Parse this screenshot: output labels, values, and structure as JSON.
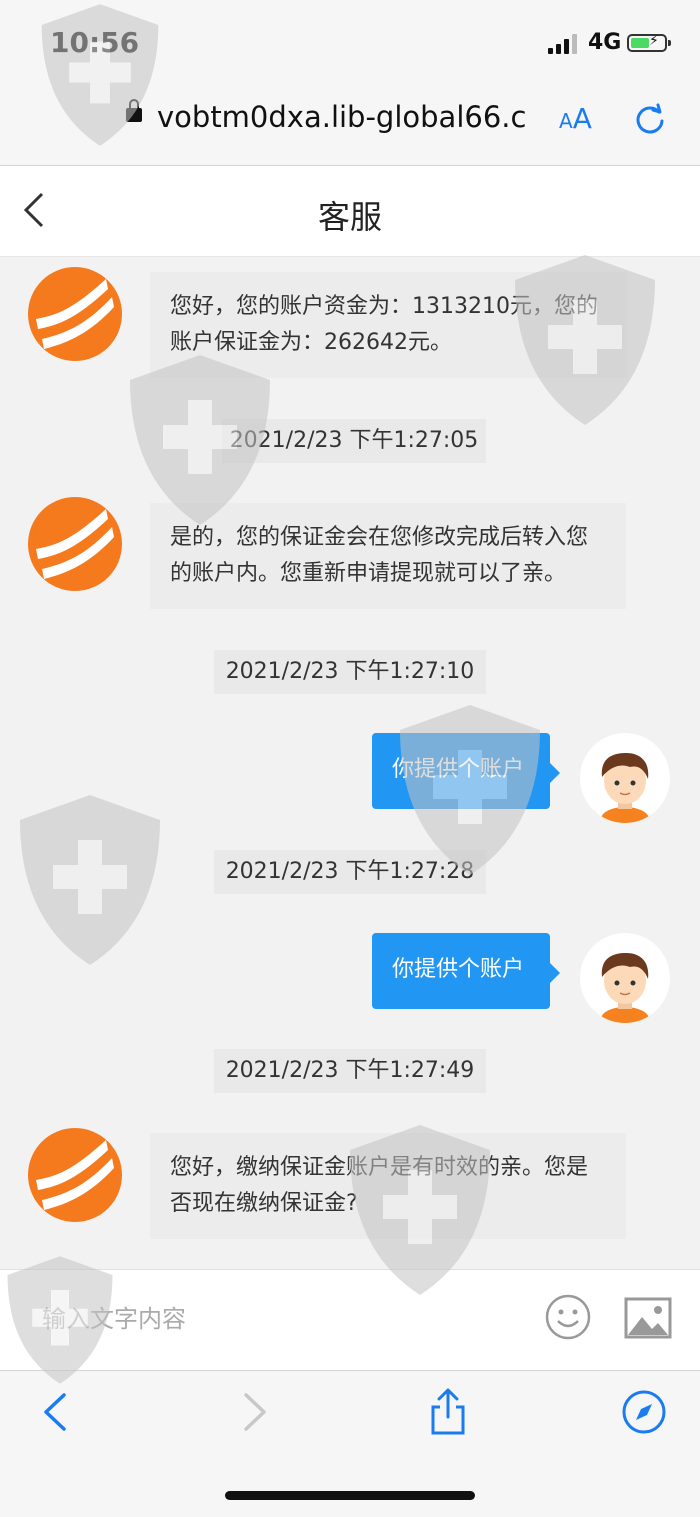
{
  "status_bar": {
    "time": "10:56",
    "network": "4G"
  },
  "browser": {
    "url": "vobtm0dxa.lib-global66.c",
    "text_size_label_small": "A",
    "text_size_label_large": "A"
  },
  "header": {
    "title": "客服"
  },
  "chat": {
    "messages": [
      {
        "from": "agent",
        "text": "您好，您的账户资金为：1313210元，您的账户保证金为：262642元。"
      },
      {
        "type": "timestamp",
        "text": "2021/2/23 下午1:27:05"
      },
      {
        "from": "agent",
        "text": "是的，您的保证金会在您修改完成后转入您的账户内。您重新申请提现就可以了亲。"
      },
      {
        "type": "timestamp",
        "text": "2021/2/23 下午1:27:10"
      },
      {
        "from": "user",
        "text": "你提供个账户"
      },
      {
        "type": "timestamp",
        "text": "2021/2/23 下午1:27:28"
      },
      {
        "from": "user",
        "text": "你提供个账户"
      },
      {
        "type": "timestamp",
        "text": "2021/2/23 下午1:27:49"
      },
      {
        "from": "agent",
        "text": "您好，缴纳保证金账户是有时效的亲。您是否现在缴纳保证金?"
      }
    ]
  },
  "input": {
    "placeholder": "输入文字内容"
  },
  "colors": {
    "accent": "#2196f3",
    "agent_avatar": "#f57a1e",
    "safari_blue": "#1a7cf0"
  }
}
